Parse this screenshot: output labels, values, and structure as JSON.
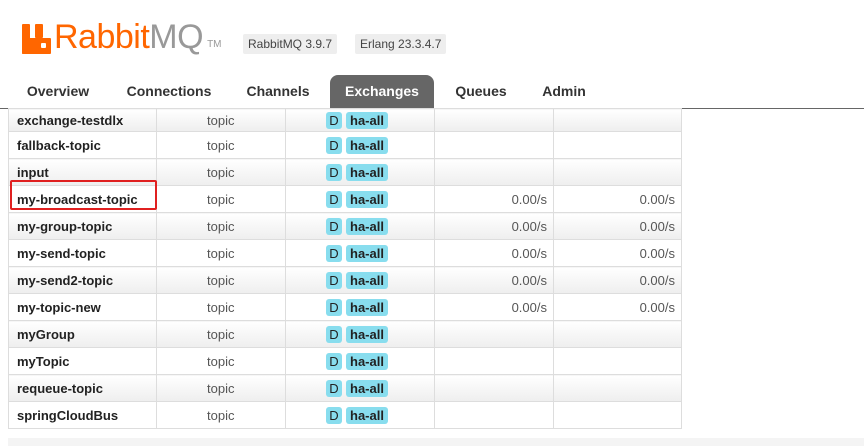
{
  "header": {
    "logo": {
      "brand": "Rabbit",
      "suffix": "MQ",
      "tm": "TM"
    },
    "rabbitmq_version": "RabbitMQ 3.9.7",
    "erlang_version": "Erlang 23.3.4.7"
  },
  "tabs": [
    {
      "label": "Overview",
      "active": false
    },
    {
      "label": "Connections",
      "active": false
    },
    {
      "label": "Channels",
      "active": false
    },
    {
      "label": "Exchanges",
      "active": true
    },
    {
      "label": "Queues",
      "active": false
    },
    {
      "label": "Admin",
      "active": false
    }
  ],
  "exchanges": [
    {
      "name": "exchange-testdlx",
      "type": "topic",
      "durable": "D",
      "policy": "ha-all",
      "rate_in": "",
      "rate_out": ""
    },
    {
      "name": "fallback-topic",
      "type": "topic",
      "durable": "D",
      "policy": "ha-all",
      "rate_in": "",
      "rate_out": ""
    },
    {
      "name": "input",
      "type": "topic",
      "durable": "D",
      "policy": "ha-all",
      "rate_in": "",
      "rate_out": ""
    },
    {
      "name": "my-broadcast-topic",
      "type": "topic",
      "durable": "D",
      "policy": "ha-all",
      "rate_in": "0.00/s",
      "rate_out": "0.00/s",
      "highlighted": true
    },
    {
      "name": "my-group-topic",
      "type": "topic",
      "durable": "D",
      "policy": "ha-all",
      "rate_in": "0.00/s",
      "rate_out": "0.00/s"
    },
    {
      "name": "my-send-topic",
      "type": "topic",
      "durable": "D",
      "policy": "ha-all",
      "rate_in": "0.00/s",
      "rate_out": "0.00/s"
    },
    {
      "name": "my-send2-topic",
      "type": "topic",
      "durable": "D",
      "policy": "ha-all",
      "rate_in": "0.00/s",
      "rate_out": "0.00/s"
    },
    {
      "name": "my-topic-new",
      "type": "topic",
      "durable": "D",
      "policy": "ha-all",
      "rate_in": "0.00/s",
      "rate_out": "0.00/s"
    },
    {
      "name": "myGroup",
      "type": "topic",
      "durable": "D",
      "policy": "ha-all",
      "rate_in": "",
      "rate_out": ""
    },
    {
      "name": "myTopic",
      "type": "topic",
      "durable": "D",
      "policy": "ha-all",
      "rate_in": "",
      "rate_out": ""
    },
    {
      "name": "requeue-topic",
      "type": "topic",
      "durable": "D",
      "policy": "ha-all",
      "rate_in": "",
      "rate_out": ""
    },
    {
      "name": "springCloudBus",
      "type": "topic",
      "durable": "D",
      "policy": "ha-all",
      "rate_in": "",
      "rate_out": ""
    }
  ],
  "colors": {
    "brand_orange": "#ff6600",
    "brand_grey": "#999999",
    "active_tab": "#666666",
    "badge_cyan": "#88ddee",
    "highlight_red": "#e02020"
  }
}
